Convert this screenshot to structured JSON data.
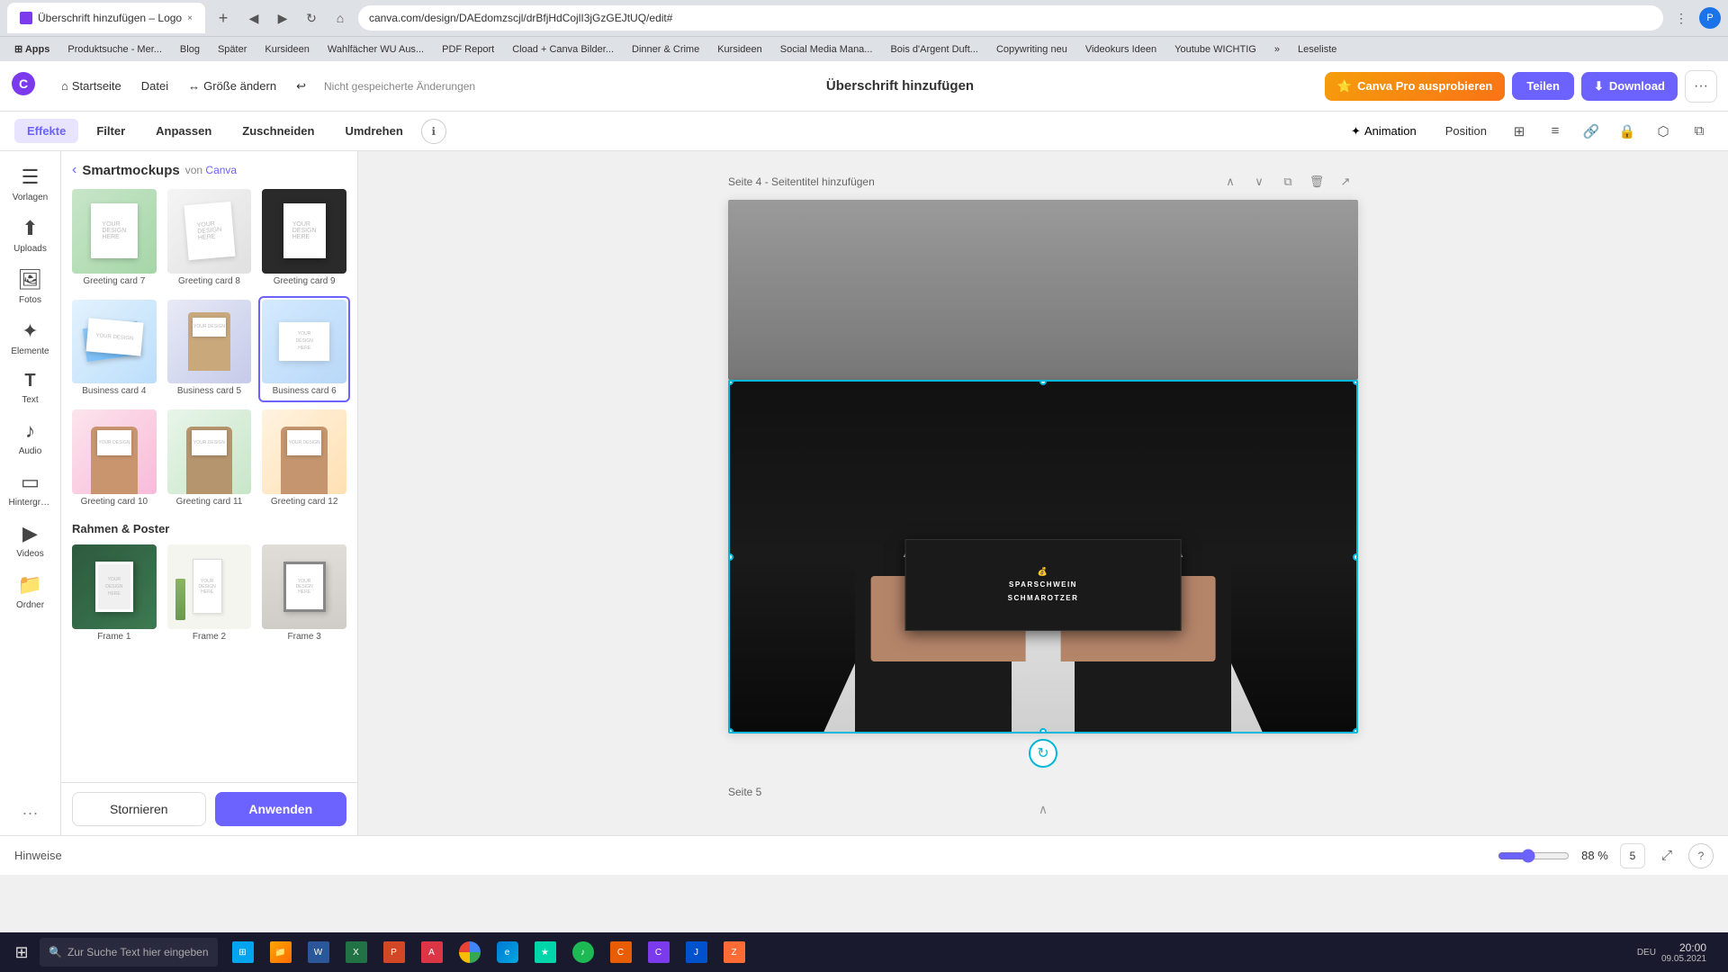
{
  "browser": {
    "tab_title": "Überschrift hinzufügen – Logo",
    "tab_close": "×",
    "tab_new": "+",
    "url": "canva.com/design/DAEdomzscjl/drBfjHdCojlI3jGzGEJtUQ/edit#",
    "back": "◀",
    "forward": "▶",
    "refresh": "↻",
    "home": "⌂",
    "bookmarks": [
      {
        "label": "Apps"
      },
      {
        "label": "Produktsuche - Mer..."
      },
      {
        "label": "Blog"
      },
      {
        "label": "Später"
      },
      {
        "label": "Kursideen"
      },
      {
        "label": "Wahlfächer WU Aus..."
      },
      {
        "label": "PDF Report"
      },
      {
        "label": "Cload + Canva Bilder..."
      },
      {
        "label": "Dinner & Crime"
      },
      {
        "label": "Kursideen"
      },
      {
        "label": "Social Media Mana..."
      },
      {
        "label": "Bois d'Argent Duft..."
      },
      {
        "label": "Copywriting neu"
      },
      {
        "label": "Videokurs Ideen"
      },
      {
        "label": "Youtube WICHTIG"
      },
      {
        "label": "»"
      },
      {
        "label": "Leseliste"
      }
    ]
  },
  "toolbar": {
    "home_label": "Startseite",
    "file_label": "Datei",
    "resize_label": "Größe ändern",
    "unsaved_label": "Nicht gespeicherte Änderungen",
    "title": "Überschrift hinzufügen",
    "canva_pro_label": "Canva Pro ausprobieren",
    "share_label": "Teilen",
    "download_label": "Download",
    "more_label": "···"
  },
  "effects_bar": {
    "tabs": [
      {
        "id": "effekte",
        "label": "Effekte",
        "active": true
      },
      {
        "id": "filter",
        "label": "Filter"
      },
      {
        "id": "anpassen",
        "label": "Anpassen"
      },
      {
        "id": "zuschneiden",
        "label": "Zuschneiden"
      },
      {
        "id": "umdrehen",
        "label": "Umdrehen"
      }
    ],
    "info_icon": "ℹ",
    "animation_label": "Animation",
    "position_label": "Position",
    "icons": [
      "⊞",
      "≡",
      "🔗",
      "🔒",
      "⬡",
      "⧉"
    ]
  },
  "sidebar": {
    "items": [
      {
        "id": "vorlagen",
        "label": "Vorlagen",
        "icon": "☰"
      },
      {
        "id": "uploads",
        "label": "Uploads",
        "icon": "⬆"
      },
      {
        "id": "fotos",
        "label": "Fotos",
        "icon": "🖼"
      },
      {
        "id": "elemente",
        "label": "Elemente",
        "icon": "✦"
      },
      {
        "id": "text",
        "label": "Text",
        "icon": "T"
      },
      {
        "id": "audio",
        "label": "Audio",
        "icon": "♪"
      },
      {
        "id": "hintergrund",
        "label": "Hintergru...",
        "icon": "▭"
      },
      {
        "id": "videos",
        "label": "Videos",
        "icon": "▶"
      },
      {
        "id": "ordner",
        "label": "Ordner",
        "icon": "📁"
      },
      {
        "id": "more",
        "label": "···",
        "icon": "···"
      }
    ]
  },
  "panel": {
    "back_icon": "‹",
    "source_label": "von",
    "source_name": "Smartmockups",
    "source_link": "Canva",
    "mockups": [
      {
        "id": "greeting7",
        "label": "Greeting card 7",
        "type": "greeting"
      },
      {
        "id": "greeting8",
        "label": "Greeting card 8",
        "type": "greeting"
      },
      {
        "id": "greeting9",
        "label": "Greeting card 9",
        "type": "greeting_dark"
      },
      {
        "id": "business4",
        "label": "Business card 4",
        "type": "business_float"
      },
      {
        "id": "business5",
        "label": "Business card 5",
        "type": "business_hand"
      },
      {
        "id": "business6",
        "label": "Business card 6",
        "type": "business_selected",
        "selected": true
      },
      {
        "id": "greeting10",
        "label": "Greeting card 10",
        "type": "greeting_hand"
      },
      {
        "id": "greeting11",
        "label": "Greeting card 11",
        "type": "greeting_hand2"
      },
      {
        "id": "greeting12",
        "label": "Greeting card 12",
        "type": "greeting_hand3"
      }
    ],
    "section_frames": "Rahmen & Poster",
    "frames": [
      {
        "id": "frame1",
        "label": "Frame 1",
        "type": "frame_green"
      },
      {
        "id": "frame2",
        "label": "Frame 2",
        "type": "frame_white"
      },
      {
        "id": "frame3",
        "label": "Frame 3",
        "type": "frame_room"
      }
    ],
    "cancel_label": "Stornieren",
    "apply_label": "Anwenden"
  },
  "canvas": {
    "page4_label": "Seite 4 - Seitentitel hinzufügen",
    "page5_label": "Seite 5",
    "page_actions": {
      "up": "∧",
      "down": "∨",
      "duplicate": "⧉",
      "delete": "🗑",
      "share": "↗"
    },
    "card_text_line1": "SPARSCHWEIN",
    "card_text_line2": "SCHMAROTZER",
    "rotate_icon": "↻",
    "bottom_rotate": "↻"
  },
  "bottom_bar": {
    "hint_label": "Hinweise",
    "zoom_value": 88,
    "zoom_pct": "88 %",
    "page_num": "5",
    "fullscreen_icon": "⤢",
    "help_icon": "?"
  },
  "taskbar": {
    "search_placeholder": "Zur Suche Text hier eingeben",
    "search_icon": "🔍",
    "time": "20:00",
    "date": "09.05.2021",
    "apps": [
      "⊞",
      "⬛",
      "📁",
      "📄",
      "📊",
      "📑",
      "🌐",
      "🌐",
      "🔵",
      "🎵",
      "📷",
      "💬",
      "🎮",
      "🎵"
    ],
    "lang": "DEU"
  }
}
